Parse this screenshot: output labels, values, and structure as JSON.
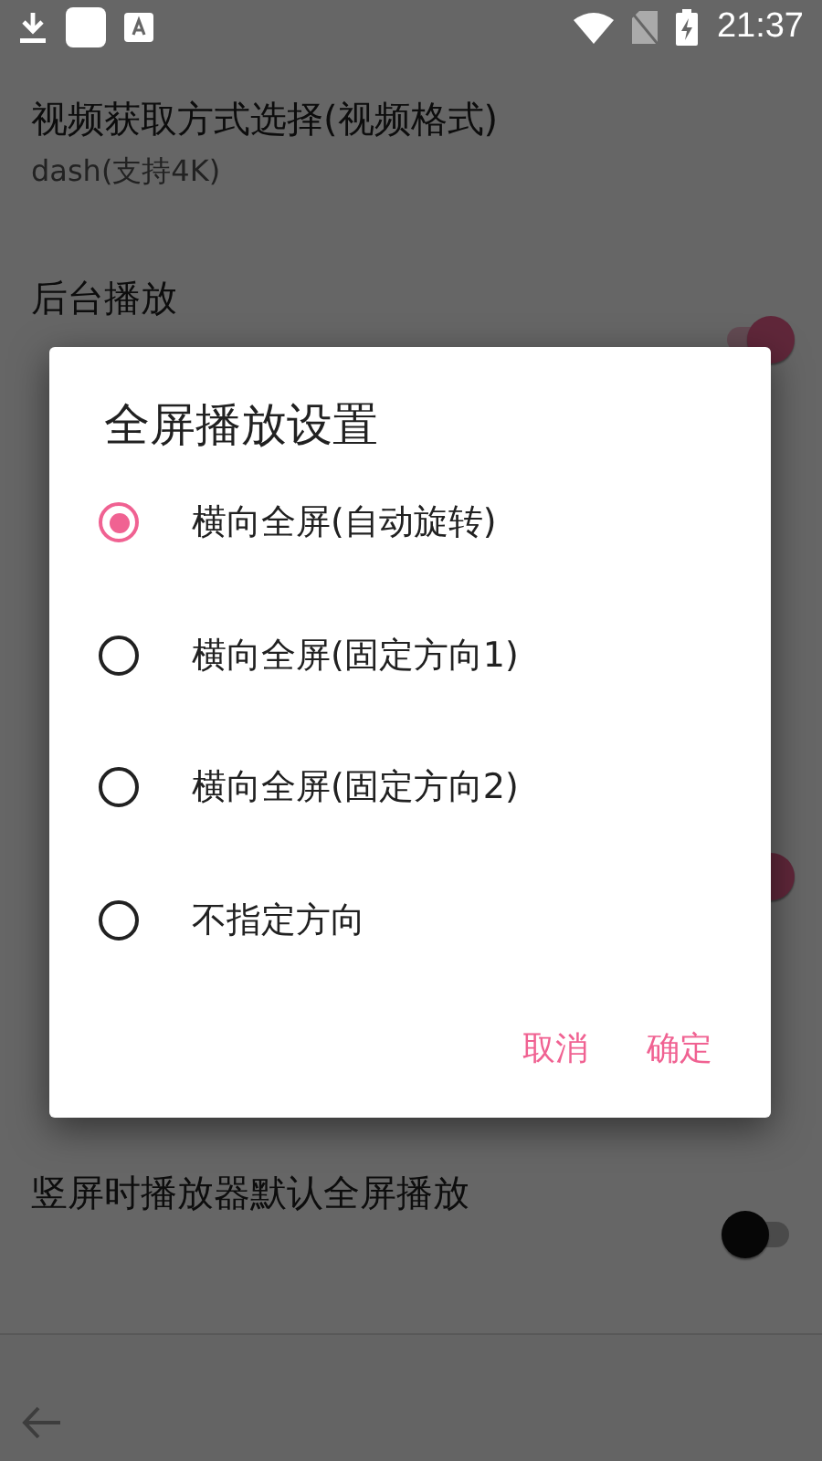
{
  "status_bar": {
    "time": "21:37"
  },
  "rows": [
    {
      "kind": "value",
      "title": "视频获取方式选择(视频格式)",
      "subtitle": "dash(支持4K)"
    },
    {
      "kind": "switch",
      "title": "后台播放",
      "on": true
    },
    {
      "kind": "blank"
    },
    {
      "kind": "blank"
    },
    {
      "kind": "switch",
      "on": true
    },
    {
      "kind": "blank"
    },
    {
      "kind": "switch",
      "title": "竖屏时播放器默认全屏播放",
      "on": false
    }
  ],
  "dialog": {
    "title": "全屏播放设置",
    "options": [
      {
        "label": "横向全屏(自动旋转)",
        "selected": true
      },
      {
        "label": "横向全屏(固定方向1)",
        "selected": false
      },
      {
        "label": "横向全屏(固定方向2)",
        "selected": false
      },
      {
        "label": "不指定方向",
        "selected": false
      }
    ],
    "buttons": [
      "取消",
      "确定"
    ]
  }
}
